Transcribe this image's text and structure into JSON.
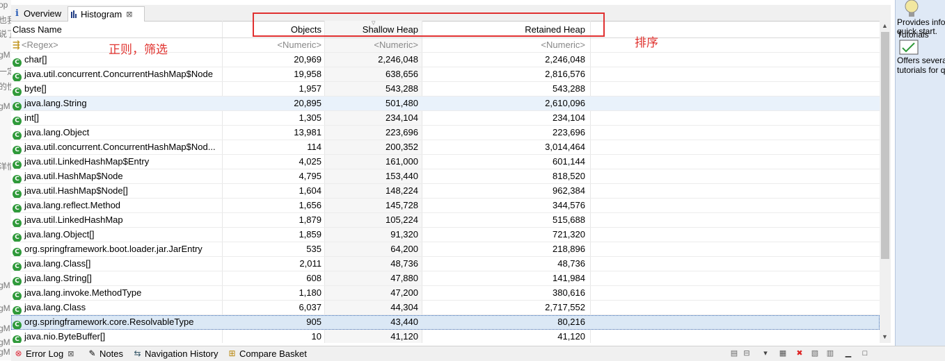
{
  "tabs": [
    {
      "label": "Overview",
      "icon": "info-icon"
    },
    {
      "label": "Histogram",
      "icon": "histogram-icon"
    }
  ],
  "columns": [
    "Class Name",
    "Objects",
    "Shallow Heap",
    "Retained Heap"
  ],
  "filters": {
    "name": "<Regex>",
    "objects": "<Numeric>",
    "shallow": "<Numeric>",
    "retained": "<Numeric>"
  },
  "rows": [
    {
      "name": "char[]",
      "objects": "20,969",
      "shallow": "2,246,048",
      "retained": "2,246,048"
    },
    {
      "name": "java.util.concurrent.ConcurrentHashMap$Node",
      "objects": "19,958",
      "shallow": "638,656",
      "retained": "2,816,576"
    },
    {
      "name": "byte[]",
      "objects": "1,957",
      "shallow": "543,288",
      "retained": "543,288"
    },
    {
      "name": "java.lang.String",
      "objects": "20,895",
      "shallow": "501,480",
      "retained": "2,610,096"
    },
    {
      "name": "int[]",
      "objects": "1,305",
      "shallow": "234,104",
      "retained": "234,104"
    },
    {
      "name": "java.lang.Object",
      "objects": "13,981",
      "shallow": "223,696",
      "retained": "223,696"
    },
    {
      "name": "java.util.concurrent.ConcurrentHashMap$Nod...",
      "objects": "114",
      "shallow": "200,352",
      "retained": "3,014,464"
    },
    {
      "name": "java.util.LinkedHashMap$Entry",
      "objects": "4,025",
      "shallow": "161,000",
      "retained": "601,144"
    },
    {
      "name": "java.util.HashMap$Node",
      "objects": "4,795",
      "shallow": "153,440",
      "retained": "818,520"
    },
    {
      "name": "java.util.HashMap$Node[]",
      "objects": "1,604",
      "shallow": "148,224",
      "retained": "962,384"
    },
    {
      "name": "java.lang.reflect.Method",
      "objects": "1,656",
      "shallow": "145,728",
      "retained": "344,576"
    },
    {
      "name": "java.util.LinkedHashMap",
      "objects": "1,879",
      "shallow": "105,224",
      "retained": "515,688"
    },
    {
      "name": "java.lang.Object[]",
      "objects": "1,859",
      "shallow": "91,320",
      "retained": "721,320"
    },
    {
      "name": "org.springframework.boot.loader.jar.JarEntry",
      "objects": "535",
      "shallow": "64,200",
      "retained": "218,896"
    },
    {
      "name": "java.lang.Class[]",
      "objects": "2,011",
      "shallow": "48,736",
      "retained": "48,736"
    },
    {
      "name": "java.lang.String[]",
      "objects": "608",
      "shallow": "47,880",
      "retained": "141,984"
    },
    {
      "name": "java.lang.invoke.MethodType",
      "objects": "1,180",
      "shallow": "47,200",
      "retained": "380,616"
    },
    {
      "name": "java.lang.Class",
      "objects": "6,037",
      "shallow": "44,304",
      "retained": "2,717,552"
    },
    {
      "name": "org.springframework.core.ResolvableType",
      "objects": "905",
      "shallow": "43,440",
      "retained": "80,216"
    },
    {
      "name": "java.nio.ByteBuffer[]",
      "objects": "10",
      "shallow": "41,120",
      "retained": "41,120"
    }
  ],
  "row_icon_letter": "C",
  "annotations": {
    "filter_note": "正则，筛选",
    "sort_note": "排序"
  },
  "right_panel": {
    "item1_lines": [
      "Provides info",
      "quick start."
    ],
    "item2_title": "Tutorials",
    "item2_lines": [
      "Offers severa",
      "tutorials for q"
    ]
  },
  "left_fragments": [
    "op",
    "也我",
    "说了",
    "gM",
    "一定",
    "的性",
    "gM",
    "洋情",
    "gM",
    "gM",
    "gM",
    "gM",
    "gM"
  ],
  "bottom_tabs": [
    {
      "label": "Error Log",
      "icon": "error-log-icon"
    },
    {
      "label": "Notes",
      "icon": "notes-icon"
    },
    {
      "label": "Navigation History",
      "icon": "navigation-history-icon"
    },
    {
      "label": "Compare Basket",
      "icon": "compare-basket-icon"
    }
  ],
  "colors": {
    "annotation": "#e0332f",
    "class_icon": "#2f9a3a",
    "selection": "#dbe8f5"
  }
}
